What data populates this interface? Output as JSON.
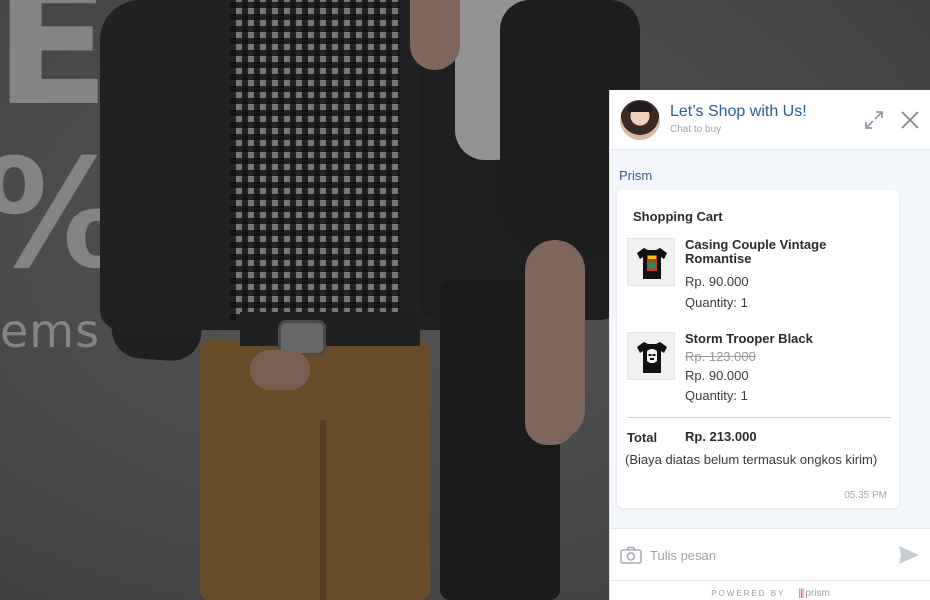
{
  "background": {
    "promo_big_letter": "E",
    "promo_percent": "%",
    "promo_items_text": "ems"
  },
  "chat": {
    "title": "Let’s Shop with Us!",
    "subtitle": "Chat to buy",
    "sender": "Prism",
    "cart": {
      "title": "Shopping Cart",
      "items": [
        {
          "name": "Casing Couple Vintage Romantise",
          "old_price": "",
          "price": "Rp. 90.000",
          "quantity": "Quantity: 1",
          "thumb_icon": "tshirt-graphic-icon"
        },
        {
          "name": "Storm Trooper Black",
          "old_price": "Rp. 123.000",
          "price": "Rp. 90.000",
          "quantity": "Quantity: 1",
          "thumb_icon": "tshirt-stormtrooper-icon"
        }
      ],
      "total_label": "Total",
      "total_value": "Rp. 213.000",
      "note": "(Biaya diatas belum termasuk ongkos kirim)",
      "timestamp": "05.35 PM"
    },
    "composer": {
      "placeholder": "Tulis pesan"
    },
    "powered_by": "POWERED BY",
    "brand": "prism"
  },
  "colors": {
    "accent": "#2e5a9a",
    "sender": "#3a5f93",
    "send_icon": "#c7ccd3"
  }
}
